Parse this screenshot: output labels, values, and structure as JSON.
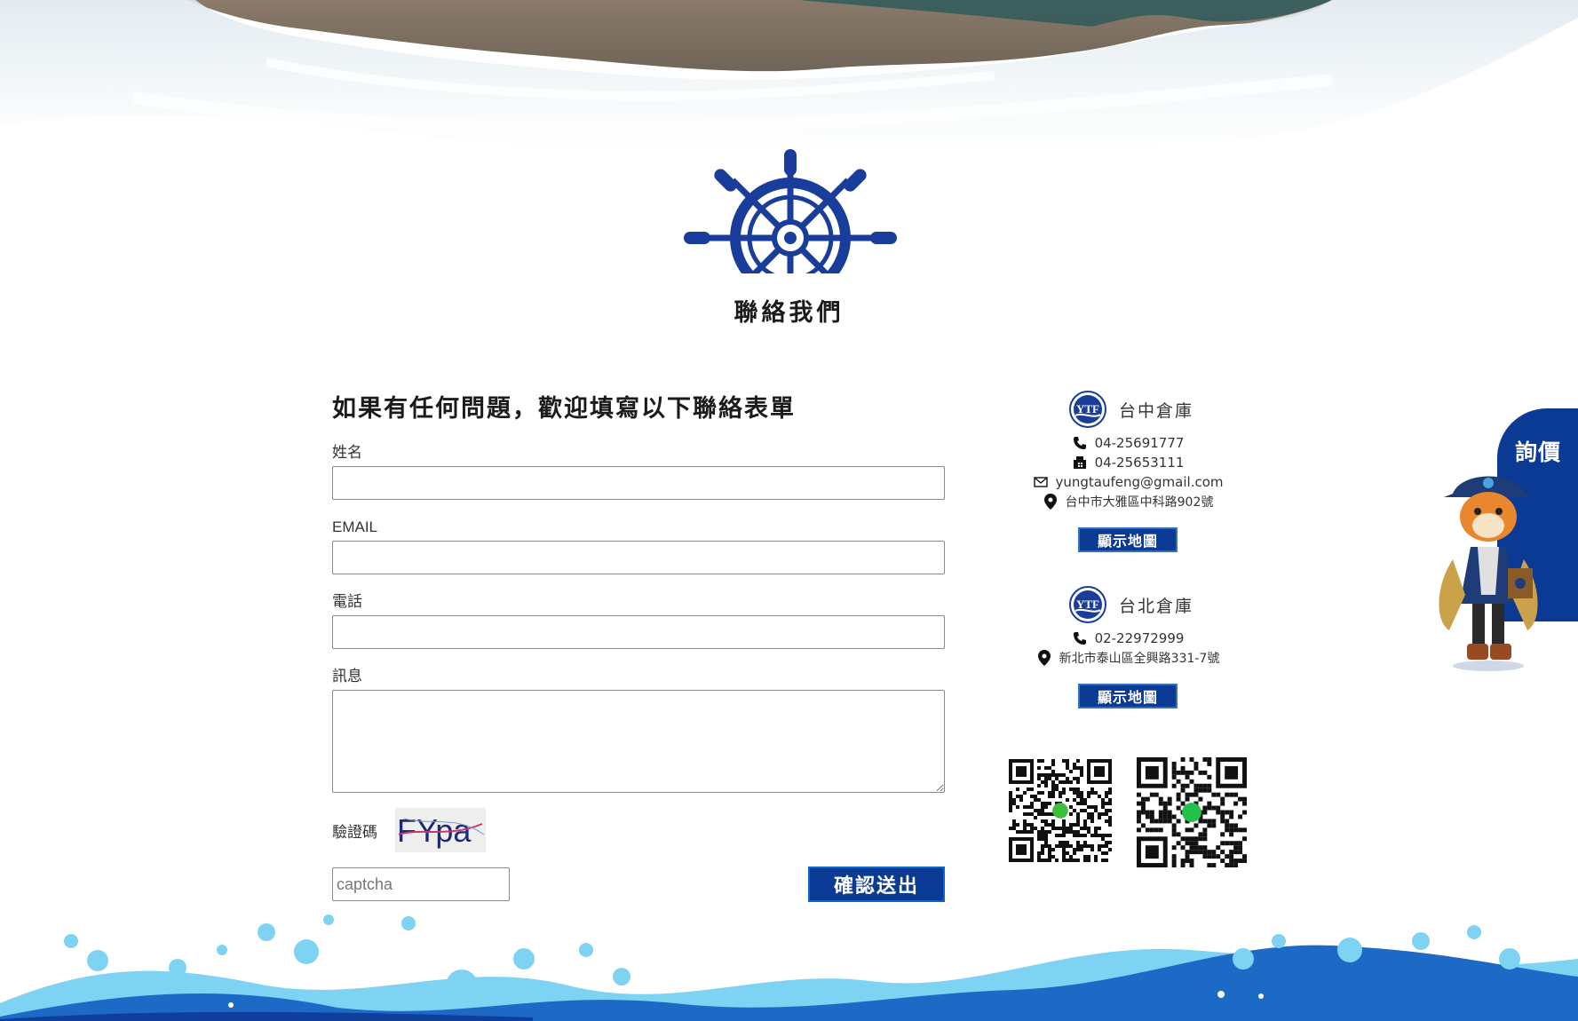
{
  "section": {
    "title": "聯絡我們"
  },
  "form": {
    "heading": "如果有任何問題，歡迎填寫以下聯絡表單",
    "name_label": "姓名",
    "email_label": "EMAIL",
    "phone_label": "電話",
    "message_label": "訊息",
    "captcha_label": "驗證碼",
    "captcha_text": "FYpa",
    "captcha_placeholder": "captcha",
    "submit_label": "確認送出"
  },
  "locations": [
    {
      "name": "台中倉庫",
      "phone": "04-25691777",
      "fax": "04-25653111",
      "email": "yungtaufeng@gmail.com",
      "address": "台中市大雅區中科路902號",
      "map_button": "顯示地圖"
    },
    {
      "name": "台北倉庫",
      "phone": "02-22972999",
      "address": "新北市泰山區全興路331-7號",
      "map_button": "顯示地圖"
    }
  ],
  "logo_text": "YTF",
  "inquiry": {
    "label": "詢價"
  },
  "colors": {
    "brand_blue": "#0a3a93",
    "wheel_blue": "#1a3d9c",
    "wave_light": "#7fd3f2",
    "wave_dark": "#1d6ac6"
  },
  "icons": [
    "ship-wheel-icon",
    "phone-icon",
    "fax-icon",
    "mail-icon",
    "location-pin-icon",
    "wechat-qr-icon",
    "line-qr-icon"
  ]
}
